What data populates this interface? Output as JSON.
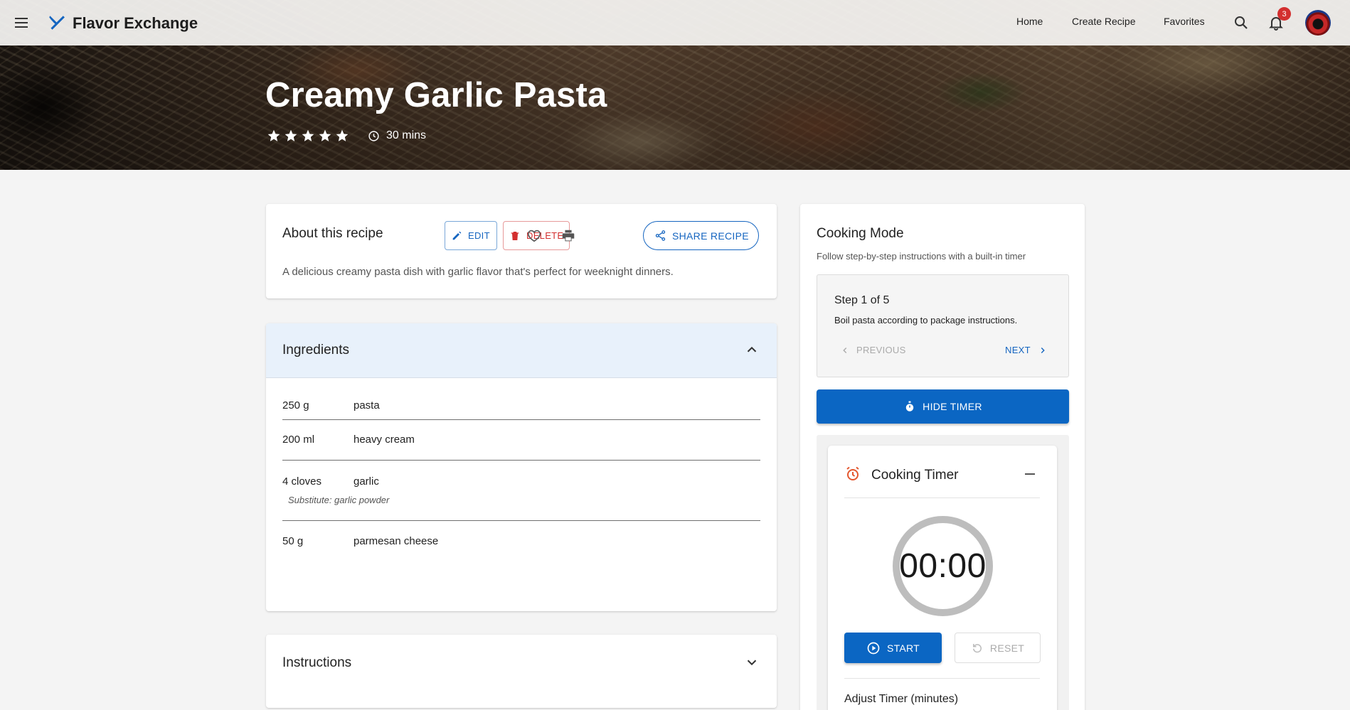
{
  "app": {
    "brand": "Flavor Exchange",
    "nav": [
      "Home",
      "Create Recipe",
      "Favorites"
    ],
    "notification_count": "3"
  },
  "hero": {
    "title": "Creamy Garlic Pasta",
    "rating": 5,
    "rating_max": 5,
    "time": "30 mins"
  },
  "about": {
    "heading": "About this recipe",
    "edit_label": "EDIT",
    "delete_label": "DELETE",
    "share_label": "SHARE RECIPE",
    "description": "A delicious creamy pasta dish with garlic flavor that's perfect for weeknight dinners."
  },
  "ingredients": {
    "heading": "Ingredients",
    "expanded": true,
    "items": [
      {
        "qty": "250 g",
        "name": "pasta",
        "substitute": ""
      },
      {
        "qty": "200 ml",
        "name": "heavy cream",
        "substitute": ""
      },
      {
        "qty": "4 cloves",
        "name": "garlic",
        "substitute": "Substitute: garlic powder"
      },
      {
        "qty": "50 g",
        "name": "parmesan cheese",
        "substitute": ""
      }
    ]
  },
  "instructions": {
    "heading": "Instructions",
    "expanded": false
  },
  "cooking_mode": {
    "heading": "Cooking Mode",
    "subtitle": "Follow step-by-step instructions with a built-in timer",
    "step_label": "Step 1 of 5",
    "step_text": "Boil pasta according to package instructions.",
    "previous_label": "PREVIOUS",
    "next_label": "NEXT",
    "hide_timer_label": "HIDE TIMER",
    "timer": {
      "title": "Cooking Timer",
      "display": "00:00",
      "start_label": "START",
      "reset_label": "RESET",
      "adjust_label": "Adjust Timer (minutes)"
    }
  },
  "colors": {
    "primary": "#0b66c3",
    "danger": "#d32f2f",
    "accent_timer_icon": "#e4572e",
    "ingredients_header_bg": "#e8f1fb"
  }
}
